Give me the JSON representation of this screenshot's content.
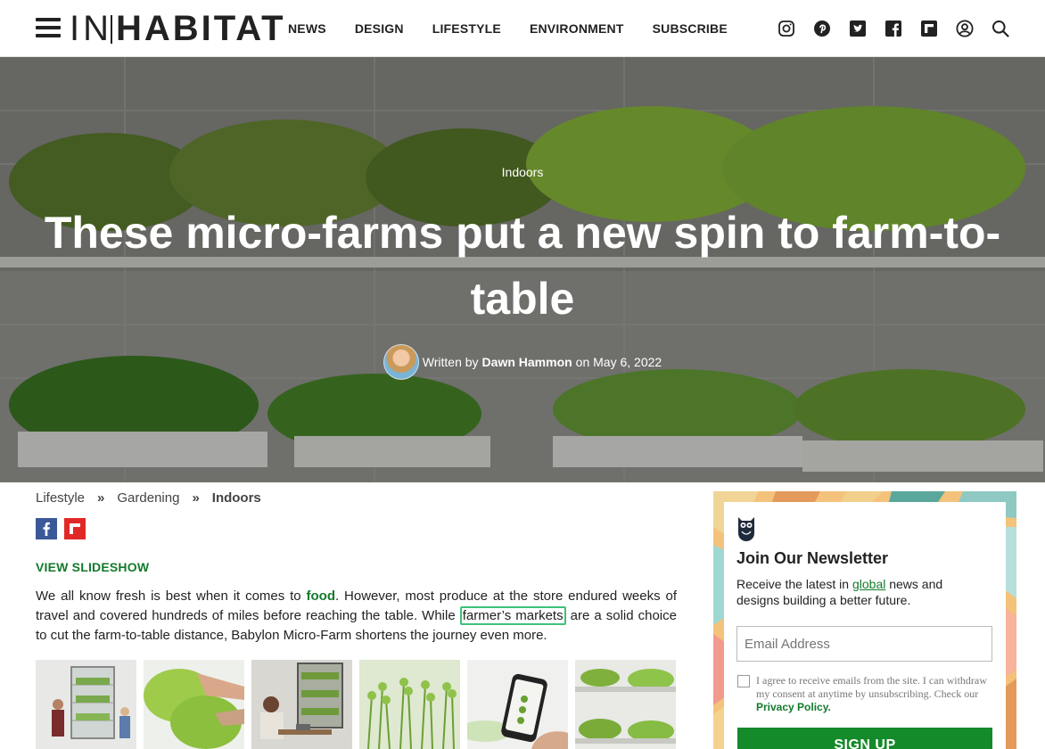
{
  "header": {
    "logo_in": "IN",
    "logo_habitat": "HABITAT",
    "nav": [
      "NEWS",
      "DESIGN",
      "LIFESTYLE",
      "ENVIRONMENT",
      "SUBSCRIBE"
    ],
    "social_icons": [
      "instagram-icon",
      "pinterest-icon",
      "twitter-icon",
      "facebook-icon",
      "flipboard-icon",
      "account-icon",
      "search-icon"
    ]
  },
  "hero": {
    "category": "Indoors",
    "title": "These micro-farms put a new spin to farm-to-table",
    "written_by": "Written by",
    "author": "Dawn Hammon",
    "on": "on",
    "date": "May 6, 2022"
  },
  "breadcrumb": {
    "items": [
      "Lifestyle",
      "Gardening",
      "Indoors"
    ],
    "separator": "»"
  },
  "article": {
    "view_slideshow": "VIEW SLIDESHOW",
    "p1_a": "We all know fresh is best when it comes to ",
    "p1_link_food": "food",
    "p1_b": ". However, most produce at the store endured weeks of travel and covered hundreds of miles before reaching the table. While ",
    "p1_link_markets": "farmer’s markets",
    "p1_c": " are a solid choice to cut the farm-to-table distance, Babylon Micro-Farm shortens the journey even more."
  },
  "newsletter": {
    "title": "Join Our Newsletter",
    "desc_a": "Receive the latest in ",
    "desc_link": "global",
    "desc_b": " news and designs building a better future.",
    "email_placeholder": "Email Address",
    "consent_text": "I agree to receive emails from the site. I can withdraw my consent at anytime by unsubscribing. Check our ",
    "privacy_link": "Privacy Policy.",
    "signup_label": "SIGN UP"
  },
  "colors": {
    "brand_green": "#137a2c",
    "button_green": "#158a2b",
    "highlight": "#3ec17a"
  }
}
